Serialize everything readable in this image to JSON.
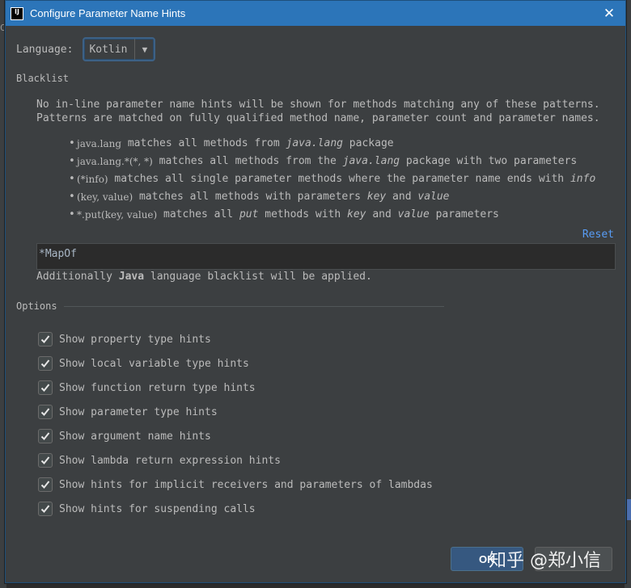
{
  "window": {
    "app_icon_text": "IJ",
    "title": "Configure Parameter Name Hints",
    "close_glyph": "✕"
  },
  "language": {
    "label": "Language:",
    "selected": "Kotlin",
    "arrow_glyph": "▼"
  },
  "blacklist": {
    "group_title": "Blacklist",
    "description": "No in-line parameter name hints will be shown for methods matching any of these patterns.\nPatterns are matched on fully qualified method name, parameter count and parameter names.",
    "bullets": [
      {
        "pattern": "java.lang",
        "text1": " matches all methods from ",
        "emph": "java.lang",
        "text2": " package"
      },
      {
        "pattern": "java.lang.*(*, *)",
        "text1": " matches all methods from the ",
        "emph": "java.lang",
        "text2": " package with two parameters"
      },
      {
        "pattern": "(*info)",
        "text1": " matches all single parameter methods where the parameter name ends with ",
        "emph": "info",
        "text2": ""
      },
      {
        "pattern": "(key, value)",
        "text1": " matches all methods with parameters ",
        "emph": "key",
        "text2": " and ",
        "emph2": "value"
      },
      {
        "pattern": "*.put(key, value)",
        "text1": " matches all ",
        "emph": "put",
        "text2": " methods with ",
        "emph2": "key",
        "text3": " and ",
        "emph3": "value",
        "text4": " parameters"
      }
    ],
    "reset_label": "Reset",
    "textarea_value": "*MapOf",
    "additional_prefix": "Additionally ",
    "additional_bold": "Java",
    "additional_suffix": " language blacklist will be applied."
  },
  "options": {
    "group_title": "Options",
    "items": [
      {
        "label": "Show property type hints",
        "checked": true
      },
      {
        "label": "Show local variable type hints",
        "checked": true
      },
      {
        "label": "Show function return type hints",
        "checked": true
      },
      {
        "label": "Show parameter type hints",
        "checked": true
      },
      {
        "label": "Show argument name hints",
        "checked": true
      },
      {
        "label": "Show lambda return expression hints",
        "checked": true
      },
      {
        "label": "Show hints for implicit receivers and parameters of lambdas",
        "checked": true
      },
      {
        "label": "Show hints for suspending calls",
        "checked": true
      }
    ]
  },
  "footer": {
    "ok_label": "OK",
    "watermark": "知乎 @郑小信"
  },
  "colors": {
    "titlebar": "#2c75b9",
    "dialog_bg": "#3c3f41",
    "text": "#bbbbbb",
    "link": "#589df6",
    "ok_button": "#365880"
  }
}
